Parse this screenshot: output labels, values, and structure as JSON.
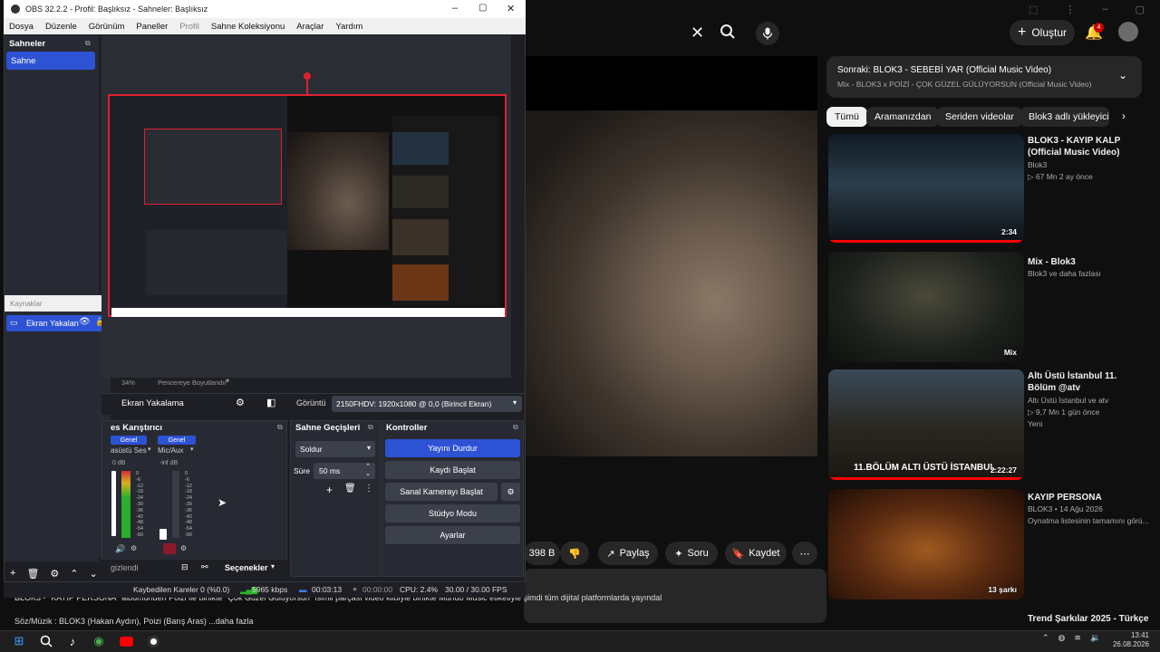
{
  "obs": {
    "title": "OBS 32.2.2 - Profil: Başlıksız - Sahneler: Başlıksız",
    "menu": [
      "Dosya",
      "Düzenle",
      "Görünüm",
      "Paneller",
      "Profil",
      "Sahne Koleksiyonu",
      "Araçlar",
      "Yardım"
    ],
    "scenes_title": "Sahneler",
    "scene_item": "Sahne",
    "sources_title": "Kaynaklar",
    "source_item": "Ekran Yakalan",
    "zoom": "34%",
    "fit_label": "Pencereye Boyutlandır",
    "source_name": "Ekran Yakalama",
    "display_label": "Görüntü",
    "display_value": "2150FHDV: 1920x1080 @ 0,0 (Birincil Ekran)",
    "mixer_title": "es Karıştırıcı",
    "mixer_ch1_badge": "Genel",
    "mixer_ch2_badge": "Genel",
    "mixer_ch1_name": "asüstü Ses",
    "mixer_ch2_name": "Mic/Aux",
    "mixer_ch1_db": "0 dB",
    "mixer_ch2_db": "-inf dB",
    "meter_scale": [
      "0",
      "-6",
      "-12",
      "-18",
      "-24",
      "-30",
      "-36",
      "-42",
      "-48",
      "-54",
      "-60"
    ],
    "transitions_title": "Sahne Geçişleri",
    "transition_value": "Soldur",
    "duration_label": "Süre",
    "duration_value": "50 ms",
    "controls_title": "Kontroller",
    "controls": [
      "Yayını Durdur",
      "Kaydı Başlat",
      "Sanal Kamerayı Başlat",
      "Stüdyo Modu",
      "Ayarlar"
    ],
    "hide_label": "gizlendi",
    "options_label": "Seçenekler",
    "status": {
      "dropped": "Kaybedilen Kareler 0 (%0.0)",
      "bitrate": "5965 kbps",
      "stream_time": "00:03:13",
      "rec_time": "00:00:00",
      "cpu": "CPU: 2.4%",
      "fps": "30.00 / 30.00 FPS"
    }
  },
  "youtube": {
    "create_label": "Oluştur",
    "notif_count": "4",
    "up_next_title": "Sonraki: BLOK3 - SEBEBİ YAR (Official Music Video)",
    "up_next_sub": "Mix - BLOK3 x POİZİ - ÇOK GÜZEL GÜLÜYORSUN (Official Music Video)",
    "chips": [
      "Tümü",
      "Aramanızdan",
      "Seriden videolar",
      "Blok3 adlı yükleyicid"
    ],
    "likes": "398 B",
    "share_label": "Paylaş",
    "ask_label": "Soru",
    "save_label": "Kaydet",
    "description": "BLOK3 - \"KAYIP PERSONA\" albümünden Poizi ile birlikte \"Çok Güzel Gülüyorsun\" isimli parçası video klibiyle birlikte Mundo Music etiketiyle şimdi tüm dijital platformlarda yayındal",
    "description2": "Söz/Müzik : BLOK3 (Hakan Aydın), Poizi (Barış Aras)     ...daha fazla",
    "recommendations": [
      {
        "title": "BLOK3 - KAYIP KALP (Official Music Video)",
        "channel": "Blok3",
        "meta": "▷ 67 Mn  2 ay önce",
        "duration": "2:34",
        "extra": ""
      },
      {
        "title": "Mix - Blok3",
        "channel": "Blok3 ve daha fazlası",
        "meta": "",
        "duration": "Mix",
        "extra": ""
      },
      {
        "title": "Altı Üstü İstanbul 11. Bölüm @atv",
        "channel": "Altı Üstü İstanbul ve atv",
        "meta": "▷ 9,7 Mn  1 gün önce",
        "duration": "2:22:27",
        "extra": "Yeni"
      },
      {
        "title": "KAYIP PERSONA",
        "channel": "BLOK3 • 14 Ağu 2026",
        "meta": "Oynatma listesinin tamamını görü...",
        "duration": "13 şarkı",
        "extra": ""
      },
      {
        "title": "Trend Şarkılar 2025 - Türkçe",
        "channel": "",
        "meta": "",
        "duration": "",
        "extra": ""
      }
    ],
    "thumb_caption": "11.BÖLÜM  ALTI ÜSTÜ İSTANBUL"
  },
  "taskbar": {
    "time": "13:41",
    "date": "26.08.2026"
  },
  "colors": {
    "accent": "#2d52d4",
    "yt_red": "#ff0000",
    "obs_bg": "#1e1f24"
  }
}
